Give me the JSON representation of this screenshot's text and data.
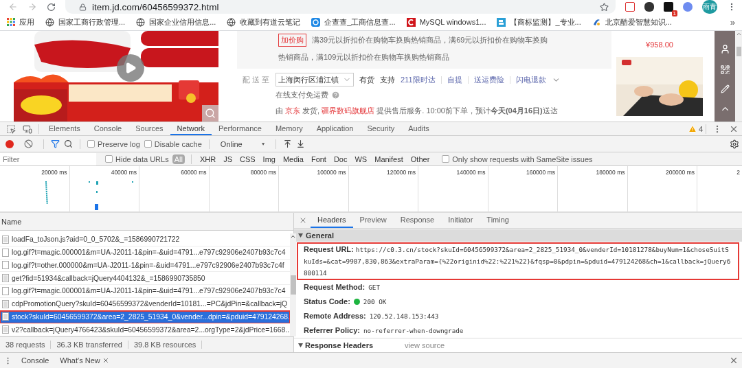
{
  "browser": {
    "url": "item.jd.com/60456599372.html",
    "extension_badge": "1",
    "profile": "雨青"
  },
  "bookmarks": {
    "items": [
      {
        "label": "应用",
        "kind": "apps"
      },
      {
        "label": "国家工商行政管理...",
        "kind": "site"
      },
      {
        "label": "国家企业信用信息...",
        "kind": "site"
      },
      {
        "label": "收藏到有道云笔记",
        "kind": "site"
      },
      {
        "label": "企查查_工商信息查...",
        "kind": "qcc"
      },
      {
        "label": "MySQL windows1...",
        "kind": "csdn"
      },
      {
        "label": "【商标监测】_专业...",
        "kind": "tm"
      },
      {
        "label": "北京酷爱智慧知识...",
        "kind": "kuai"
      }
    ],
    "overflow": "»"
  },
  "page": {
    "promo": {
      "tag": "加价购",
      "lines": [
        "满39元以折扣价在购物车换购热销商品，满69元以折扣价在购物车换购",
        "热销商品，满109元以折扣价在购物车换购热销商品"
      ]
    },
    "delivery": {
      "label": "配 送 至",
      "location": "上海闵行区浦江镇",
      "stock": "有货",
      "support_label": "支持",
      "services": [
        "211限时达",
        "自提",
        "送运费险",
        "闪电退款"
      ]
    },
    "shipping_note": "在线支付免运费",
    "fulfillment": [
      {
        "text": "由 ",
        "kind": "plain"
      },
      {
        "text": "京东",
        "kind": "link"
      },
      {
        "text": " 发货, ",
        "kind": "plain"
      },
      {
        "text": "疆界数码旗舰店",
        "kind": "link"
      },
      {
        "text": " 提供售后服务. 10:00前下单，预计",
        "kind": "plain"
      },
      {
        "text": "今天(04月16日)",
        "kind": "bold"
      },
      {
        "text": "送达",
        "kind": "plain"
      }
    ],
    "side_ad": {
      "price": "¥958.00"
    }
  },
  "devtools": {
    "tabs": [
      {
        "label": "Elements",
        "selected": false
      },
      {
        "label": "Console",
        "selected": false
      },
      {
        "label": "Sources",
        "selected": false
      },
      {
        "label": "Network",
        "selected": true
      },
      {
        "label": "Performance",
        "selected": false
      },
      {
        "label": "Memory",
        "selected": false
      },
      {
        "label": "Application",
        "selected": false
      },
      {
        "label": "Security",
        "selected": false
      },
      {
        "label": "Audits",
        "selected": false
      }
    ],
    "warnings": "4",
    "toolbar": {
      "recording": true,
      "filter_active": true,
      "preserve_log": {
        "label": "Preserve log",
        "checked": false
      },
      "disable_cache": {
        "label": "Disable cache",
        "checked": false
      },
      "throttling": "Online"
    },
    "filter": {
      "placeholder": "Filter",
      "hide_data_urls": {
        "label": "Hide data URLs",
        "checked": false
      },
      "types": [
        {
          "label": "All",
          "selected": true
        },
        {
          "label": "XHR",
          "selected": false
        },
        {
          "label": "JS",
          "selected": false
        },
        {
          "label": "CSS",
          "selected": false
        },
        {
          "label": "Img",
          "selected": false
        },
        {
          "label": "Media",
          "selected": false
        },
        {
          "label": "Font",
          "selected": false
        },
        {
          "label": "Doc",
          "selected": false
        },
        {
          "label": "WS",
          "selected": false
        },
        {
          "label": "Manifest",
          "selected": false
        },
        {
          "label": "Other",
          "selected": false
        }
      ],
      "samesite_only": {
        "label": "Only show requests with SameSite issues",
        "checked": false
      }
    },
    "timeline": {
      "ticks": [
        "20000 ms",
        "40000 ms",
        "60000 ms",
        "80000 ms",
        "100000 ms",
        "120000 ms",
        "140000 ms",
        "160000 ms",
        "180000 ms",
        "200000 ms",
        "2"
      ]
    },
    "requests": {
      "column": "Name",
      "rows": [
        {
          "name": "loadFa_toJson.js?aid=0_0_5702&_=1586990721722",
          "kind": "document",
          "selected": false,
          "annotated": false
        },
        {
          "name": "log.gif?t=magic.000001&m=UA-J2011-1&pin=-&uid=4791...e797c92906e2407b93c7c4",
          "selected": false,
          "annotated": false
        },
        {
          "name": "log.gif?t=other.000000&m=UA-J2011-1&pin=-&uid=4791...e797c92906e2407b93c7c4f",
          "selected": false,
          "annotated": false
        },
        {
          "name": "get?fid=51934&callback=jQuery4404132&_=1586990735850",
          "kind": "document",
          "selected": false,
          "annotated": false
        },
        {
          "name": "log.gif?t=magic.000001&m=UA-J2011-1&pin=-&uid=4791...e797c92906e2407b93c7c4",
          "selected": false,
          "annotated": false
        },
        {
          "name": "cdpPromotionQuery?skuId=60456599372&venderId=10181...=PC&jdPin=&callback=jQ",
          "kind": "document",
          "selected": false,
          "annotated": false
        },
        {
          "name": "stock?skuId=60456599372&area=2_2825_51934_0&vender...dpin=&pduid=479124268.",
          "kind": "document",
          "selected": true,
          "annotated": true
        },
        {
          "name": "v2?callback=jQuery4766423&skuId=60456599372&area=2...orgType=2&jdPrice=1668..",
          "kind": "document",
          "selected": false,
          "annotated": false
        }
      ],
      "summary": [
        "38 requests",
        "36.3 KB transferred",
        "39.8 KB resources"
      ]
    },
    "detail": {
      "tabs": [
        {
          "label": "Headers",
          "selected": true
        },
        {
          "label": "Preview",
          "selected": false
        },
        {
          "label": "Response",
          "selected": false
        },
        {
          "label": "Initiator",
          "selected": false
        },
        {
          "label": "Timing",
          "selected": false
        }
      ],
      "general": {
        "title": "General",
        "expanded": true,
        "fields": [
          {
            "label": "Request URL:",
            "value": "https://c0.3.cn/stock?skuId=60456599372&area=2_2825_51934_0&venderId=10181278&buyNum=1&choseSuitSkuIds=&cat=9987,830,863&extraParam={%22originid%22:%221%22}&fqsp=0&pdpin=&pduid=479124268&ch=1&callback=jQuery6800114",
            "kind": "url",
            "annotated": true
          },
          {
            "label": "Request Method:",
            "value": "GET",
            "kind": "text",
            "annotated": false
          },
          {
            "label": "Status Code:",
            "value": "200 OK",
            "kind": "status",
            "annotated": false
          },
          {
            "label": "Remote Address:",
            "value": "120.52.148.153:443",
            "kind": "text",
            "annotated": false
          },
          {
            "label": "Referrer Policy:",
            "value": "no-referrer-when-downgrade",
            "kind": "text",
            "annotated": false
          }
        ]
      },
      "response_headers": {
        "title": "Response Headers",
        "expanded": true,
        "action": "view source"
      }
    },
    "drawer": {
      "tabs": [
        {
          "label": "Console",
          "closable": false
        },
        {
          "label": "What's New",
          "closable": true
        }
      ]
    }
  }
}
